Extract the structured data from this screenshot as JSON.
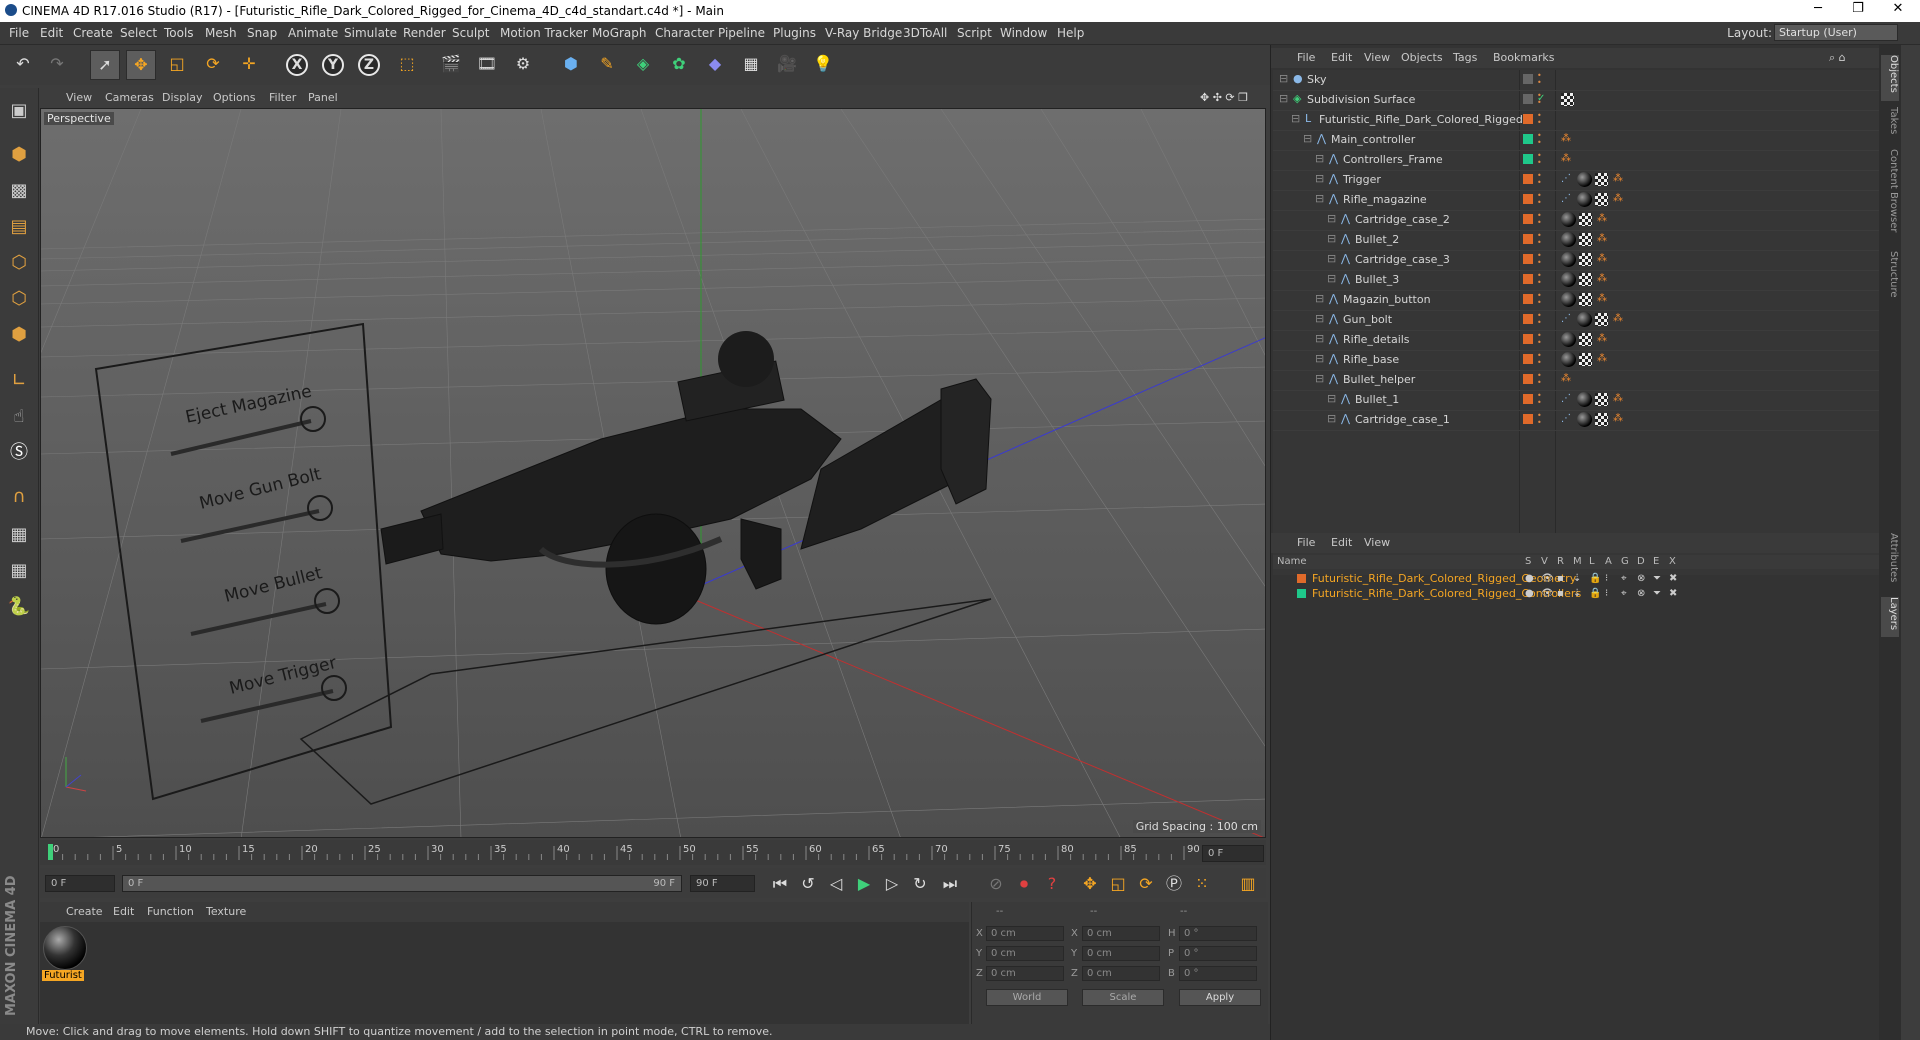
{
  "window": {
    "title": "CINEMA 4D R17.016 Studio (R17) - [Futuristic_Rifle_Dark_Colored_Rigged_for_Cinema_4D_c4d_standart.c4d *] - Main",
    "controls": [
      "─",
      "❐",
      "✕"
    ]
  },
  "menu": [
    "File",
    "Edit",
    "Create",
    "Select",
    "Tools",
    "Mesh",
    "Snap",
    "Animate",
    "Simulate",
    "Render",
    "Sculpt",
    "Motion Tracker",
    "MoGraph",
    "Character",
    "Pipeline",
    "Plugins",
    "V-Ray Bridge",
    "3DToAll",
    "Script",
    "Window",
    "Help"
  ],
  "layout": {
    "label": "Layout:",
    "value": "Startup (User)"
  },
  "viewport": {
    "menu": [
      "View",
      "Cameras",
      "Display",
      "Options",
      "Filter",
      "Panel"
    ],
    "label": "Perspective",
    "grid_spacing": "Grid Spacing : 100 cm",
    "rig_labels": [
      "Eject Magazine",
      "Move Gun Bolt",
      "Move Bullet",
      "Move Trigger"
    ]
  },
  "timeline": {
    "ticks": [
      "0",
      "5",
      "10",
      "15",
      "20",
      "25",
      "30",
      "35",
      "40",
      "45",
      "50",
      "55",
      "60",
      "65",
      "70",
      "75",
      "80",
      "85",
      "90"
    ],
    "current": "0 F",
    "start": "0 F",
    "range_start": "0 F",
    "range_end": "90 F",
    "end": "90 F"
  },
  "material": {
    "menu": [
      "Create",
      "Edit",
      "Function",
      "Texture"
    ],
    "name": "Futurist"
  },
  "coords": {
    "headers": [
      "--",
      "--",
      "--"
    ],
    "rows": [
      {
        "a": "X",
        "av": "0 cm",
        "b": "X",
        "bv": "0 cm",
        "c": "H",
        "cv": "0 °"
      },
      {
        "a": "Y",
        "av": "0 cm",
        "b": "Y",
        "bv": "0 cm",
        "c": "P",
        "cv": "0 °"
      },
      {
        "a": "Z",
        "av": "0 cm",
        "b": "Z",
        "bv": "0 cm",
        "c": "B",
        "cv": "0 °"
      }
    ],
    "world": "World",
    "scale": "Scale",
    "apply": "Apply"
  },
  "status": "Move: Click and drag to move elements. Hold down SHIFT to quantize movement / add to the selection in point mode, CTRL to remove.",
  "objects": {
    "menu": [
      "File",
      "Edit",
      "View",
      "Objects",
      "Tags",
      "Bookmarks"
    ],
    "items": [
      {
        "name": "Sky",
        "indent": 0,
        "layer": "",
        "tags": ""
      },
      {
        "name": "Subdivision Surface",
        "indent": 0,
        "layer": "",
        "tags": "check"
      },
      {
        "name": "Futuristic_Rifle_Dark_Colored_Rigged",
        "indent": 1,
        "layer": "#e06a2a",
        "tags": ""
      },
      {
        "name": "Main_controller",
        "indent": 2,
        "layer": "#1fc88a",
        "tags": "d"
      },
      {
        "name": "Controllers_Frame",
        "indent": 3,
        "layer": "#1fc88a",
        "tags": "d"
      },
      {
        "name": "Trigger",
        "indent": 3,
        "layer": "#e06a2a",
        "tags": "xbcd"
      },
      {
        "name": "Rifle_magazine",
        "indent": 3,
        "layer": "#e06a2a",
        "tags": "xbcd"
      },
      {
        "name": "Cartridge_case_2",
        "indent": 4,
        "layer": "#e06a2a",
        "tags": "bcd"
      },
      {
        "name": "Bullet_2",
        "indent": 4,
        "layer": "#e06a2a",
        "tags": "bcd"
      },
      {
        "name": "Cartridge_case_3",
        "indent": 4,
        "layer": "#e06a2a",
        "tags": "bcd"
      },
      {
        "name": "Bullet_3",
        "indent": 4,
        "layer": "#e06a2a",
        "tags": "bcd"
      },
      {
        "name": "Magazin_button",
        "indent": 3,
        "layer": "#e06a2a",
        "tags": "bcd"
      },
      {
        "name": "Gun_bolt",
        "indent": 3,
        "layer": "#e06a2a",
        "tags": "xbcd"
      },
      {
        "name": "Rifle_details",
        "indent": 3,
        "layer": "#e06a2a",
        "tags": "bcd"
      },
      {
        "name": "Rifle_base",
        "indent": 3,
        "layer": "#e06a2a",
        "tags": "bcd"
      },
      {
        "name": "Bullet_helper",
        "indent": 3,
        "layer": "#e06a2a",
        "tags": "d"
      },
      {
        "name": "Bullet_1",
        "indent": 4,
        "layer": "#e06a2a",
        "tags": "xbcd"
      },
      {
        "name": "Cartridge_case_1",
        "indent": 4,
        "layer": "#e06a2a",
        "tags": "xbcd"
      }
    ]
  },
  "layers": {
    "menu": [
      "File",
      "Edit",
      "View"
    ],
    "columns": [
      "Name",
      "S",
      "V",
      "R",
      "M",
      "L",
      "A",
      "G",
      "D",
      "E",
      "X"
    ],
    "items": [
      {
        "name": "Futuristic_Rifle_Dark_Colored_Rigged_Geometry",
        "color": "#e06a2a"
      },
      {
        "name": "Futuristic_Rifle_Dark_Colored_Rigged_Controllers",
        "color": "#1fc88a"
      }
    ]
  },
  "side_tabs": [
    "Objects",
    "Takes",
    "Content Browser",
    "Structure",
    "Attributes",
    "Layers"
  ],
  "colors": {
    "accent": "#f5a623",
    "selection": "#e06a2a",
    "controller": "#1fc88a"
  }
}
